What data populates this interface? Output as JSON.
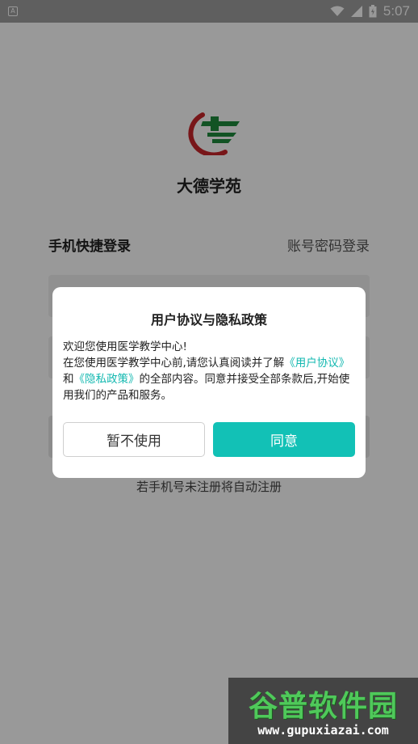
{
  "status_bar": {
    "notification_icon": "A",
    "time": "5:07",
    "icons": [
      "wifi-icon",
      "signal-icon",
      "battery-icon"
    ]
  },
  "app": {
    "name": "大德学苑",
    "logo_icon": "cross-logo-icon",
    "colors": {
      "logo_red": "#c8262b",
      "logo_green": "#1f8a3c"
    }
  },
  "login": {
    "tab_quick": "手机快捷登录",
    "tab_account": "账号密码登录",
    "hint": "若手机号未注册将自动注册"
  },
  "dialog": {
    "title": "用户协议与隐私政策",
    "line1": "欢迎您使用医学教学中心!",
    "line2_prefix": "在您使用医学教学中心前,请您认真阅读并了解",
    "link_user_agreement": "《用户协议》",
    "connector": "和",
    "link_privacy_policy": "《隐私政策》",
    "line2_suffix": "的全部内容。同意并接受全部条款后,开始使用我们的产品和服务。",
    "button_cancel": "暂不使用",
    "button_agree": "同意",
    "colors": {
      "accent": "#12c1b6",
      "link": "#12b8b0"
    }
  },
  "watermark": {
    "text_cn": "谷普软件园",
    "url": "www.gupuxiazai.com"
  }
}
